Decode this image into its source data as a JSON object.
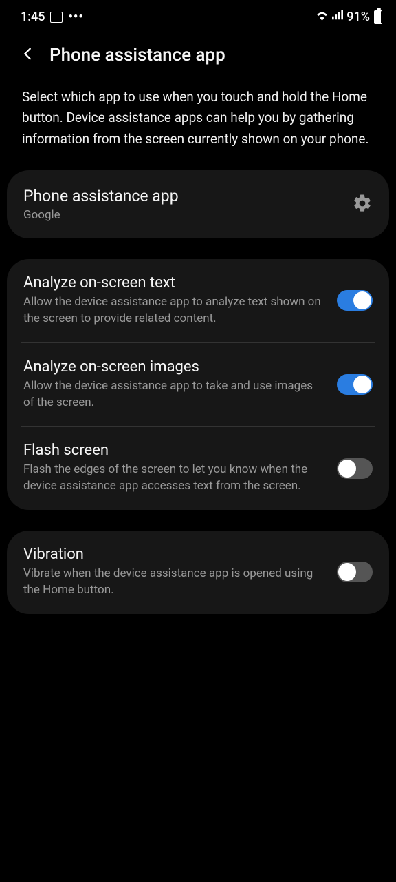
{
  "statusBar": {
    "time": "1:45",
    "battery": "91%"
  },
  "header": {
    "title": "Phone assistance app"
  },
  "description": "Select which app to use when you touch and hold the Home button. Device assistance apps can help you by gathering information from the screen currently shown on your phone.",
  "appSelector": {
    "title": "Phone assistance app",
    "value": "Google"
  },
  "settings": {
    "analyzeText": {
      "title": "Analyze on-screen text",
      "desc": "Allow the device assistance app to analyze text shown on the screen to provide related content.",
      "enabled": true
    },
    "analyzeImages": {
      "title": "Analyze on-screen images",
      "desc": "Allow the device assistance app to take and use images of the screen.",
      "enabled": true
    },
    "flashScreen": {
      "title": "Flash screen",
      "desc": "Flash the edges of the screen to let you know when the device assistance app accesses text from the screen.",
      "enabled": false
    },
    "vibration": {
      "title": "Vibration",
      "desc": "Vibrate when the device assistance app is opened using the Home button.",
      "enabled": false
    }
  }
}
